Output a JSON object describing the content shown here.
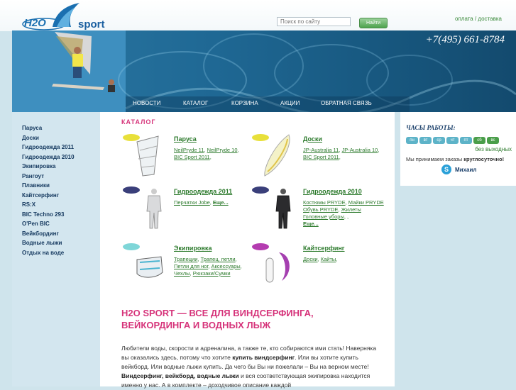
{
  "header": {
    "logo_left": "H2O",
    "logo_right": "sport",
    "search_placeholder": "Поиск по сайту",
    "search_button": "Найти",
    "link_payment": "оплата",
    "link_sep": " / ",
    "link_delivery": "доставка",
    "phone": "+7(495) 661-8784"
  },
  "nav": [
    "НОВОСТИ",
    "КАТАЛОГ",
    "КОРЗИНА",
    "АКЦИИ",
    "ОБРАТНАЯ СВЯЗЬ"
  ],
  "sidebar": [
    "Паруса",
    "Доски",
    "Гидроодежда 2011",
    "Гидроодежда 2010",
    "Экипировка",
    "Рангоут",
    "Плавники",
    "Кайтсерфинг",
    "RS:X",
    "BIC Techno 293",
    "O'Pen BIC",
    "Вейкбординг",
    "Водные лыжи",
    "Отдых на воде"
  ],
  "catalog": {
    "title": "КАТАЛОГ",
    "sails": {
      "title": "Паруса",
      "links": [
        "NeilPryde 11",
        "NeilPryde 10",
        "BIC Sport 2011"
      ]
    },
    "boards": {
      "title": "Доски",
      "links": [
        "JP-Australia 11",
        "JP-Australia 10",
        "BIC Sport 2011"
      ]
    },
    "wetsuits11": {
      "title": "Гидроодежда 2011",
      "links": [
        "Перчатки Jobe"
      ],
      "more": "Еще..."
    },
    "wetsuits10": {
      "title": "Гидроодежда 2010",
      "links": [
        "Костюмы PRYDE",
        "Майки PRYDE",
        "Обувь PRYDE",
        "Жилеты",
        "Головные уборы"
      ],
      "more": "Еще..."
    },
    "gear": {
      "title": "Экипировка",
      "links": [
        "Трапеции",
        "Трапец. петли",
        "Петли для ног",
        "Аксессуары",
        "Чехлы",
        "Рюкзаки/Сумки"
      ]
    },
    "kite": {
      "title": "Кайтсерфинг",
      "links": [
        "Доски",
        "Кайты"
      ]
    }
  },
  "heading": "H2O SPORT — ВСЕ ДЛЯ ВИНДСЕРФИНГА, ВЕЙКОРДИНГА И ВОДНЫХ ЛЫЖ",
  "body": {
    "p1": "Любители воды, скорости и адреналина, а также те, кто собираются ими стать! Наверняка вы оказались здесь, потому что хотите ",
    "b1": "купить виндсерфинг",
    "p2": ". Или вы хотите купить вейкборд. Или водные лыжи купить. Да чего бы Вы ни пожелали – Вы на верном месте! ",
    "b2": "Виндсерфинг, вейкборд, водные лыжи",
    "p3": " и вся соответствующая экипировка находится именно у нас. А в комплекте – доходчивое описание каждой"
  },
  "hours": {
    "title": "ЧАСЫ РАБОТЫ:",
    "days": [
      "пн",
      "вт",
      "ср",
      "чт",
      "пт",
      "сб",
      "вс"
    ],
    "no_days_off": "без выходных",
    "orders": "Мы принимаем заказы ",
    "orders_bold": "круглосуточно!",
    "skype_name": "Михаил"
  },
  "colors": {
    "accent_pink": "#d6337a",
    "link_green": "#2c7a2c",
    "banner_blue": "#1f6894"
  }
}
